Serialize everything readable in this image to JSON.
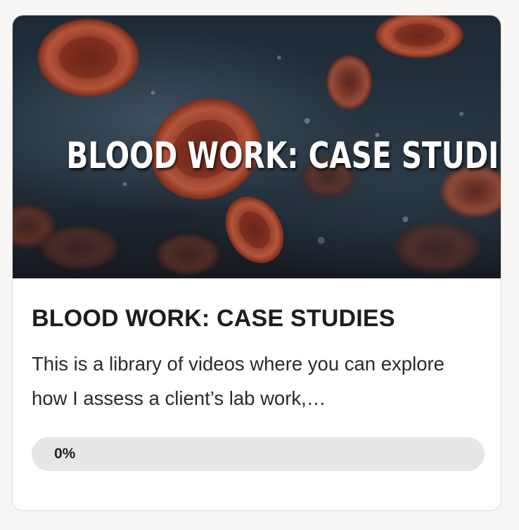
{
  "course": {
    "hero_title": "BLOOD WORK: CASE STUDIES",
    "title": "BLOOD WORK: CASE STUDIES",
    "description": "This is a library of videos where you can explore how I assess a client’s lab work,…",
    "progress": {
      "percent": 0,
      "label": "0%"
    }
  },
  "colors": {
    "card_background": "#ffffff",
    "page_background": "#f7f6f4",
    "progress_track": "#e6e6e6",
    "blood_cell": "#a8482e"
  }
}
